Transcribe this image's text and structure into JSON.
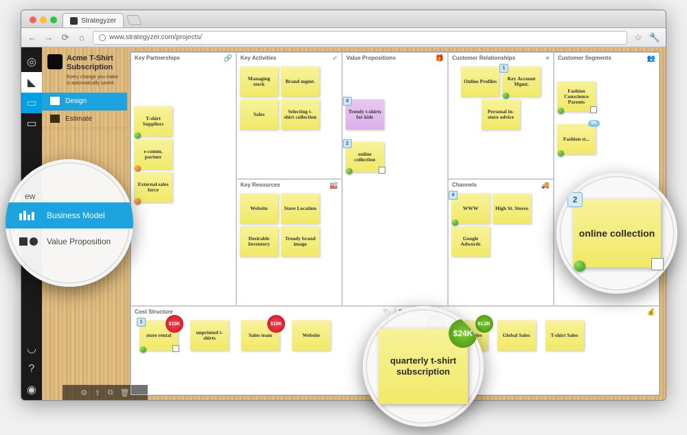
{
  "browser": {
    "tab_title": "Strategyzer",
    "url": "www.strategyzer.com/projects/"
  },
  "project": {
    "title": "Acme T-Shirt Subscription",
    "hint": "Every change you make is automatically saved."
  },
  "sidebar": {
    "design": "Design",
    "estimate": "Estimate"
  },
  "lens_nav": {
    "peek": "ew",
    "business_model": "Business Model",
    "value_proposition": "Value Proposition"
  },
  "zoom_note_sub": {
    "text": "quarterly t-shirt subscription",
    "price": "$24K"
  },
  "zoom_note_coll": {
    "text": "online collection",
    "badge": "2"
  },
  "canvas": {
    "kp": {
      "title": "Key Partnerships",
      "notes": [
        {
          "t": "T-shirt Suppliers",
          "dot": "g"
        },
        {
          "t": "e-comm. partner",
          "dot": "o"
        },
        {
          "t": "External sales force",
          "dot": "o"
        }
      ]
    },
    "ka": {
      "title": "Key Activities",
      "notes": [
        {
          "t": "Managing stock"
        },
        {
          "t": "Brand mgmt."
        },
        {
          "t": "Sales"
        },
        {
          "t": "Selecting t-shirt collection"
        }
      ]
    },
    "kr": {
      "title": "Key Resources",
      "notes": [
        {
          "t": "Website"
        },
        {
          "t": "Store Location"
        },
        {
          "t": "Desirable Inventory"
        },
        {
          "t": "Trendy brand image"
        }
      ]
    },
    "vp": {
      "title": "Value Propositions",
      "notes": [
        {
          "t": "Trendy t-shirts for kids",
          "badge": "4",
          "purple": true
        },
        {
          "t": "online collection",
          "badge": "2",
          "dot": "g",
          "sq": true
        }
      ]
    },
    "cr": {
      "title": "Customer Relationships",
      "notes": [
        {
          "t": "Online Profiles"
        },
        {
          "t": "Key Account Mgmt.",
          "badge": "1",
          "dot": "g"
        },
        {
          "t": "Personal in-store advice"
        }
      ]
    },
    "ch": {
      "title": "Channels",
      "notes": [
        {
          "t": "WWW",
          "badge": "4",
          "dot": "g"
        },
        {
          "t": "High St. Stores"
        },
        {
          "t": "Google Adwords"
        }
      ]
    },
    "cs": {
      "title": "Customer Segments",
      "notes": [
        {
          "t": "Fashion Conscience Parents",
          "dot": "g",
          "sq": true
        },
        {
          "t": "Fashion st...",
          "dot": "g",
          "bubble": "5K"
        }
      ]
    },
    "cost": {
      "title": "Cost Structure",
      "notes": [
        {
          "t": "store rental",
          "badge": "1",
          "dot": "g",
          "sq": true,
          "burst": "$10K",
          "bcolor": "red"
        },
        {
          "t": "unprinted t-shirts"
        },
        {
          "t": "Sales team",
          "burst": "$10K",
          "bcolor": "red"
        },
        {
          "t": "Website"
        }
      ]
    },
    "rev": {
      "title": "Revenue Streams",
      "notes": [
        {
          "t": "quarterly t-shirt subscription",
          "burst": "$24K",
          "bcolor": "grn"
        },
        {
          "t": "Online Sales",
          "dot": "g",
          "burst": "$1.2K",
          "bcolor": "grn"
        },
        {
          "t": "Global Sales"
        },
        {
          "t": "T-shirt Sales"
        }
      ]
    }
  }
}
